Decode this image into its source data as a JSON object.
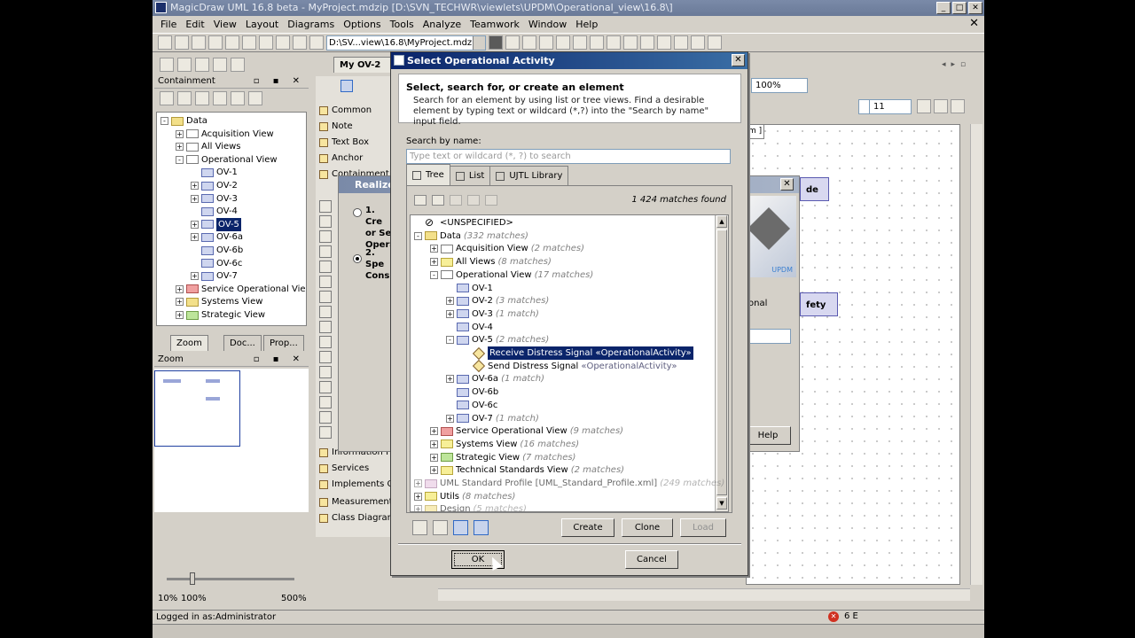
{
  "app": {
    "title": "MagicDraw UML 16.8 beta - MyProject.mdzip [D:\\SVN_TECHWR\\viewlets\\UPDM\\Operational_view\\16.8\\]",
    "menu": [
      "File",
      "Edit",
      "View",
      "Layout",
      "Diagrams",
      "Options",
      "Tools",
      "Analyze",
      "Teamwork",
      "Window",
      "Help"
    ],
    "project_path": "D:\\SV...view\\16.8\\MyProject.mdzip",
    "diagram_tab": "My OV-2",
    "zoom_combo": "100%",
    "font_size": "11",
    "status_text": "Logged in as:Administrator",
    "error_count": "6 E"
  },
  "containment": {
    "title": "Containment",
    "items": [
      {
        "label": "Data",
        "depth": 0,
        "icon": "folder",
        "exp": "-"
      },
      {
        "label": "Acquisition View",
        "depth": 1,
        "icon": "folder-white",
        "exp": "+"
      },
      {
        "label": "All Views",
        "depth": 1,
        "icon": "folder-white",
        "exp": "+"
      },
      {
        "label": "Operational View",
        "depth": 1,
        "icon": "folder-white",
        "exp": "-"
      },
      {
        "label": "OV-1",
        "depth": 2,
        "icon": "pkg",
        "exp": ""
      },
      {
        "label": "OV-2",
        "depth": 2,
        "icon": "pkg",
        "exp": "+"
      },
      {
        "label": "OV-3",
        "depth": 2,
        "icon": "pkg",
        "exp": "+"
      },
      {
        "label": "OV-4",
        "depth": 2,
        "icon": "pkg",
        "exp": ""
      },
      {
        "label": "OV-5",
        "depth": 2,
        "icon": "pkg",
        "exp": "+",
        "selected": true
      },
      {
        "label": "OV-6a",
        "depth": 2,
        "icon": "pkg",
        "exp": "+"
      },
      {
        "label": "OV-6b",
        "depth": 2,
        "icon": "pkg",
        "exp": ""
      },
      {
        "label": "OV-6c",
        "depth": 2,
        "icon": "pkg",
        "exp": ""
      },
      {
        "label": "OV-7",
        "depth": 2,
        "icon": "pkg",
        "exp": "+"
      },
      {
        "label": "Service Operational Vie",
        "depth": 1,
        "icon": "folder-red",
        "exp": "+"
      },
      {
        "label": "Systems View",
        "depth": 1,
        "icon": "folder",
        "exp": "+"
      },
      {
        "label": "Strategic View",
        "depth": 1,
        "icon": "folder-green",
        "exp": "+"
      }
    ]
  },
  "side_tabs": [
    "Zoom",
    "Doc...",
    "Prop..."
  ],
  "zoom_panel": {
    "title": "Zoom",
    "left_label": "10%",
    "mid_label": "100%",
    "right_label": "500%"
  },
  "palette": {
    "items": [
      "Common",
      "Note",
      "Text Box",
      "Anchor",
      "Containment",
      "Information Fl...",
      "Services",
      "Implements O...",
      "Measurement",
      "Class Diagram"
    ]
  },
  "behind_dialog": {
    "title": "Realize",
    "opt1": "1. Cre or Se Opera",
    "opt2": "2. Spe Consu",
    "help": "Help",
    "field_right": "onal",
    "node_top": "de",
    "node_bottom": "fety",
    "logo_caption": "UPDM"
  },
  "canvas": {
    "frame_label": "m ]"
  },
  "dialog": {
    "title": "Select Operational Activity",
    "heading": "Select, search for, or create an element",
    "description": "Search for an element by using list or tree views. Find a desirable element by typing text or wildcard (*,?) into the \"Search by name\" input field.",
    "search_label": "Search by name:",
    "search_placeholder": "Type text or wildcard (*, ?) to search",
    "tabs": [
      "Tree",
      "List",
      "UJTL Library"
    ],
    "matches": "1 424 matches found",
    "tree": [
      {
        "label": "<UNSPECIFIED>",
        "count": "",
        "depth": 0,
        "icon": "none",
        "exp": ""
      },
      {
        "label": "Data",
        "count": "(332 matches)",
        "depth": 0,
        "icon": "folder",
        "exp": "-"
      },
      {
        "label": "Acquisition View",
        "count": "(2 matches)",
        "depth": 1,
        "icon": "folder-white",
        "exp": "+"
      },
      {
        "label": "All Views",
        "count": "(8 matches)",
        "depth": 1,
        "icon": "folder-y",
        "exp": "+"
      },
      {
        "label": "Operational View",
        "count": "(17 matches)",
        "depth": 1,
        "icon": "folder-white",
        "exp": "-"
      },
      {
        "label": "OV-1",
        "count": "",
        "depth": 2,
        "icon": "pkg",
        "exp": ""
      },
      {
        "label": "OV-2",
        "count": "(3 matches)",
        "depth": 2,
        "icon": "pkg",
        "exp": "+"
      },
      {
        "label": "OV-3",
        "count": "(1 match)",
        "depth": 2,
        "icon": "pkg",
        "exp": "+"
      },
      {
        "label": "OV-4",
        "count": "",
        "depth": 2,
        "icon": "pkg",
        "exp": ""
      },
      {
        "label": "OV-5",
        "count": "(2 matches)",
        "depth": 2,
        "icon": "pkg",
        "exp": "-"
      },
      {
        "label": "Receive Distress Signal «OperationalActivity»",
        "count": "",
        "depth": 3,
        "icon": "activity",
        "exp": "",
        "selected": true
      },
      {
        "label": "Send Distress Signal",
        "count": "«OperationalActivity»",
        "depth": 3,
        "icon": "activity",
        "exp": ""
      },
      {
        "label": "OV-6a",
        "count": "(1 match)",
        "depth": 2,
        "icon": "pkg",
        "exp": "+"
      },
      {
        "label": "OV-6b",
        "count": "",
        "depth": 2,
        "icon": "pkg",
        "exp": ""
      },
      {
        "label": "OV-6c",
        "count": "",
        "depth": 2,
        "icon": "pkg",
        "exp": ""
      },
      {
        "label": "OV-7",
        "count": "(1 match)",
        "depth": 2,
        "icon": "pkg",
        "exp": "+"
      },
      {
        "label": "Service Operational View",
        "count": "(9 matches)",
        "depth": 1,
        "icon": "folder-red",
        "exp": "+"
      },
      {
        "label": "Systems View",
        "count": "(16 matches)",
        "depth": 1,
        "icon": "folder-y",
        "exp": "+"
      },
      {
        "label": "Strategic View",
        "count": "(7 matches)",
        "depth": 1,
        "icon": "folder-green",
        "exp": "+"
      },
      {
        "label": "Technical Standards View",
        "count": "(2 matches)",
        "depth": 1,
        "icon": "folder-y",
        "exp": "+"
      },
      {
        "label": "UML Standard Profile [UML_Standard_Profile.xml]",
        "count": "(249 matches)",
        "depth": 0,
        "icon": "folder-pk",
        "exp": "+",
        "dim": true
      },
      {
        "label": "Utils",
        "count": "(8 matches)",
        "depth": 0,
        "icon": "folder-y",
        "exp": "+"
      },
      {
        "label": "Design",
        "count": "(5 matches)",
        "depth": 0,
        "icon": "folder",
        "exp": "+",
        "dim": true
      }
    ],
    "btn_create": "Create",
    "btn_clone": "Clone",
    "btn_load": "Load",
    "btn_ok": "OK",
    "btn_cancel": "Cancel"
  },
  "colors": {
    "selection": "#0a246a",
    "titlebar_active": "#0a246a",
    "face": "#d4d0c8"
  }
}
